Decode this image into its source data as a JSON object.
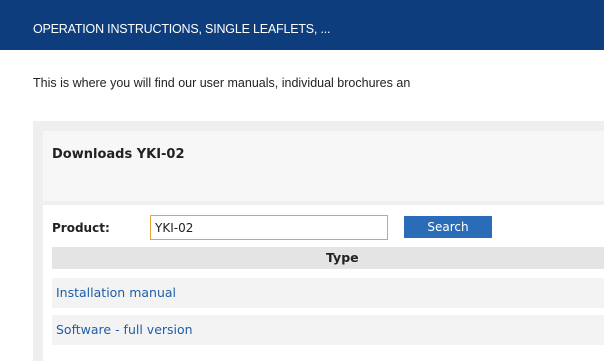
{
  "header": {
    "title": "OPERATION INSTRUCTIONS, SINGLE LEAFLETS, ..."
  },
  "intro": {
    "text": "This is where you will find our user manuals, individual brochures an"
  },
  "downloads": {
    "title": "Downloads YKI-02",
    "product_label": "Product:",
    "product_value": "YKI-02",
    "search_label": "Search",
    "type_header": "Type",
    "rows": [
      {
        "label": "Installation manual"
      },
      {
        "label": "Software - full version"
      }
    ]
  },
  "colors": {
    "header_bg": "#0d3d7c",
    "button_bg": "#2b6cb8",
    "link": "#1f5ea8",
    "input_border": "#e8a23c"
  }
}
